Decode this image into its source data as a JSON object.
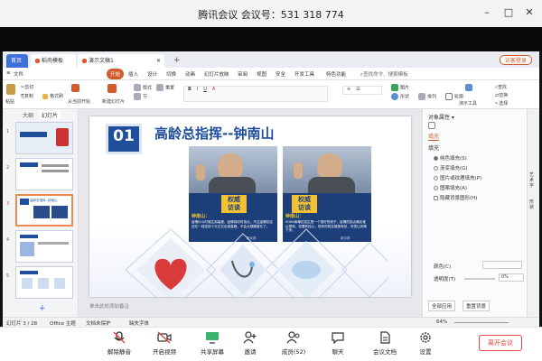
{
  "window": {
    "title": "腾讯会议 会议号：531 318 774",
    "minimize": "–",
    "maximize": "□",
    "close": "✕"
  },
  "wps": {
    "tabs": [
      "首页",
      "稻壳模板",
      "演示文稿1"
    ],
    "new_tab": "+",
    "login_button": "访客登录",
    "menu": [
      "文件",
      "开始",
      "插入",
      "设计",
      "切换",
      "动画",
      "幻灯片放映",
      "审阅",
      "视图",
      "安全",
      "开发工具",
      "特色功能"
    ],
    "search_hint": "查找命令、搜索模板",
    "toolbar": {
      "paste": "粘贴",
      "cut": "剪切",
      "copy": "复制",
      "format_painter": "格式刷",
      "from_current": "从当前开始",
      "new_slide": "新建幻灯片",
      "layout": "版式",
      "section": "节",
      "reset": "重置",
      "image": "图片",
      "shape": "形状",
      "arrange": "排列",
      "outline": "轮廓",
      "presenter": "演示工具",
      "find": "查找",
      "replace": "替换",
      "select": "选择"
    },
    "left_tabs": [
      "大纲",
      "幻灯片"
    ],
    "thumb_numbers": [
      "1",
      "2",
      "3",
      "4",
      "5"
    ],
    "thumb3_title": "高龄总指挥--钟南山",
    "add_slide": "+",
    "notes_placeholder": "单击此处添加备注",
    "status": {
      "slide_info": "幻灯片 3 / 28",
      "theme": "Office 主题",
      "protect": "文档未保护",
      "font_missing": "缺失字体",
      "zoom": "64%"
    },
    "right_pane": {
      "title": "对象属性 ▾",
      "tab": "填充",
      "section": "填充",
      "options": [
        "纯色填充(S)",
        "渐变填充(G)",
        "图片或纹理填充(P)",
        "图案填充(A)",
        "隐藏背景图形(H)"
      ],
      "color_label": "颜色(C)",
      "transparency_label": "透明度(T)",
      "transparency_value": "0%",
      "apply_all": "全部应用",
      "reset_bg": "重置背景"
    },
    "right_strip": [
      "艺术字",
      "形状"
    ]
  },
  "slide": {
    "number": "01",
    "title": "高龄总指挥--钟南山",
    "badge": "权威\n访谈",
    "left_caption_name": "钟南山：",
    "left_caption_text": "疫情什么时候达到高峰，疫情将何时拐点，不过疫情防控还在一线坚持十天左右出现高峰，不会大规模增长了。",
    "right_caption_name": "钟南山：",
    "right_caption_text": "SOBS病毒的发生是一个很好的例子，疫情的拐点确实难以预测，但要有信心，现有的防控措施有效，尽快让其降下来。",
    "footer_tag": "新京报"
  },
  "meeting": {
    "mute": "解除静音",
    "video": "开启视频",
    "share": "共享屏幕",
    "invite": "邀请",
    "members": "成员(52)",
    "chat": "聊天",
    "docs": "会议文档",
    "settings": "设置",
    "leave": "离开会议"
  },
  "colors": {
    "accent_blue": "#1f4e9a",
    "wps_orange": "#d35a2b",
    "leave_red": "#e0463c"
  }
}
